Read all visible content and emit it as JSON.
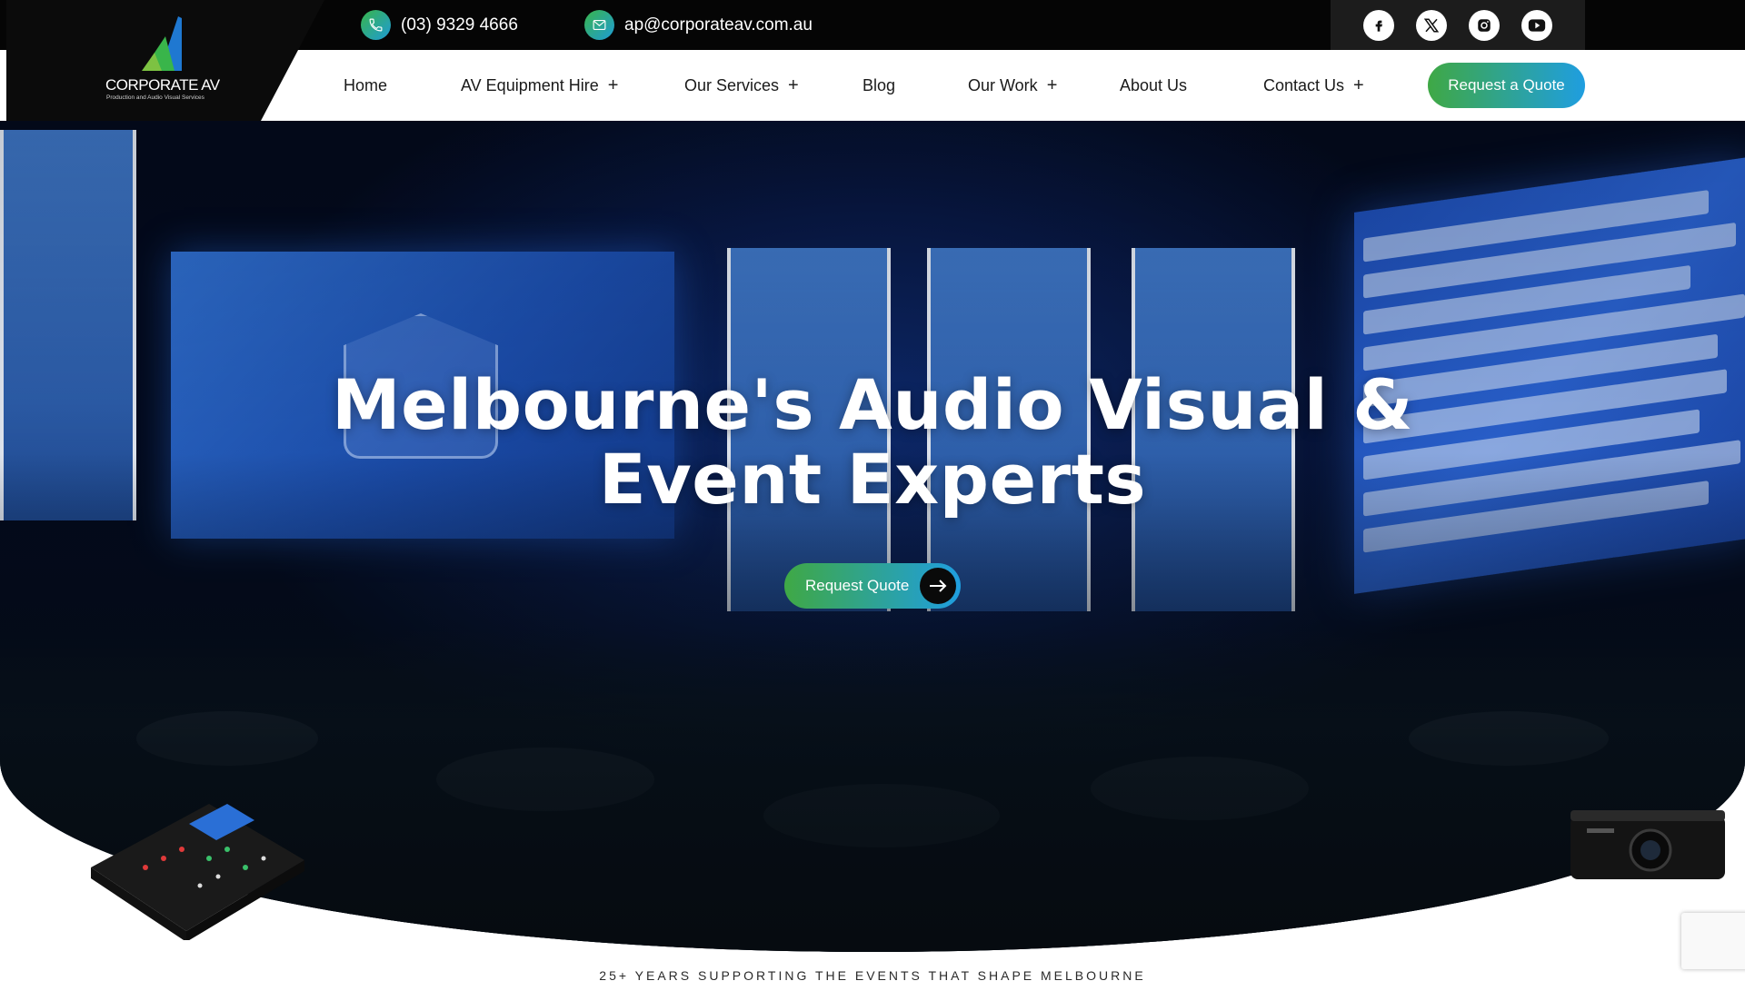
{
  "brand": {
    "name": "CORPORATE AV",
    "tagline": "Production and Audio Visual Services"
  },
  "topbar": {
    "phone": "(03) 9329 4666",
    "email": "ap@corporateav.com.au",
    "socials": [
      "facebook-icon",
      "x-icon",
      "instagram-icon",
      "youtube-icon"
    ]
  },
  "nav": {
    "items": [
      {
        "label": "Home"
      },
      {
        "label": "AV Equipment Hire",
        "expand": "+"
      },
      {
        "label": "Our Services",
        "expand": "+"
      },
      {
        "label": "Blog"
      },
      {
        "label": "Our Work",
        "expand": "+"
      },
      {
        "label": "About Us"
      },
      {
        "label": "Contact Us",
        "expand": "+"
      }
    ],
    "cta": "Request a Quote"
  },
  "hero": {
    "title_line1": "Melbourne's Audio Visual &",
    "title_line2": "Event Experts",
    "cta": "Request Quote"
  },
  "section": {
    "tagline": "25+ YEARS SUPPORTING THE EVENTS THAT SHAPE MELBOURNE"
  },
  "colors": {
    "accent_green": "#3fa845",
    "accent_blue": "#1f9ee0",
    "topbar_bg": "#050505"
  }
}
